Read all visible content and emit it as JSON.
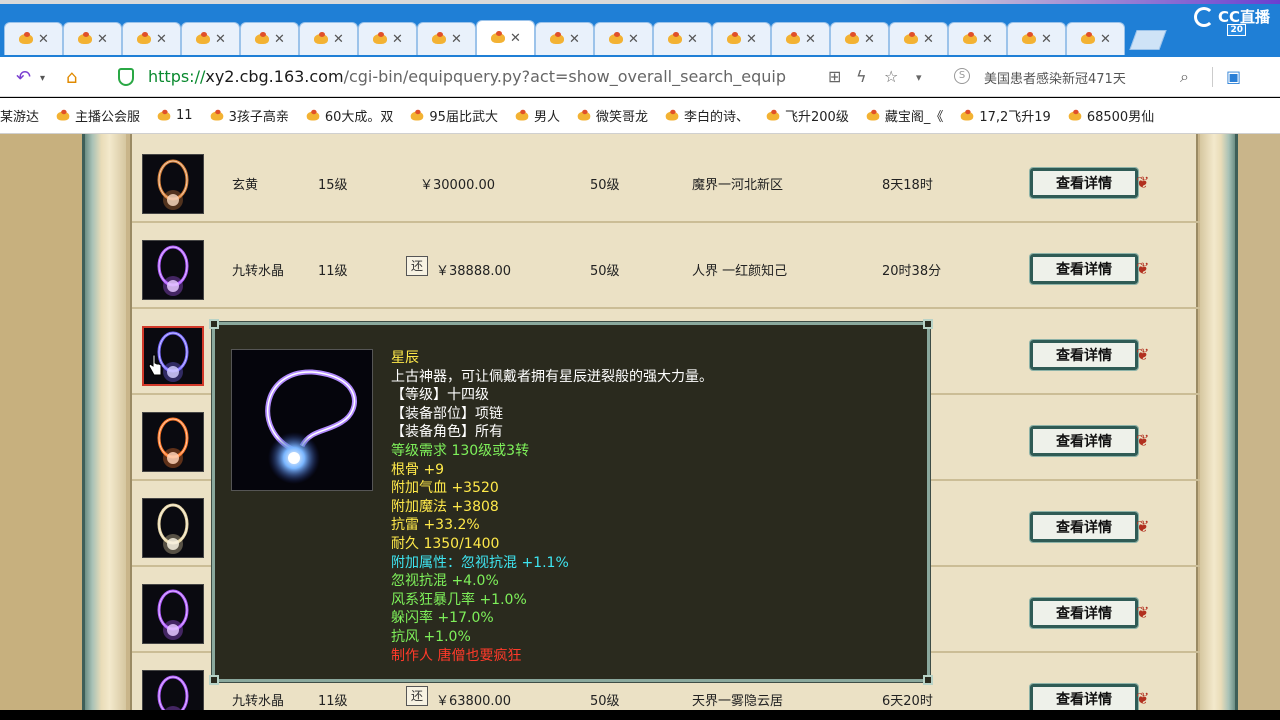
{
  "browser": {
    "tabs": [
      {
        "active": false
      },
      {
        "active": false
      },
      {
        "active": false
      },
      {
        "active": false
      },
      {
        "active": false
      },
      {
        "active": false
      },
      {
        "active": false
      },
      {
        "active": false
      },
      {
        "active": true
      },
      {
        "active": false
      },
      {
        "active": false
      },
      {
        "active": false
      },
      {
        "active": false
      },
      {
        "active": false
      },
      {
        "active": false
      },
      {
        "active": false
      },
      {
        "active": false
      },
      {
        "active": false
      },
      {
        "active": false
      }
    ],
    "tab_close_glyph": "✕",
    "stream_logo": "CC直播",
    "stream_badge": "20",
    "url_scheme": "https://",
    "url_host": "xy2.cbg.163.com",
    "url_path": "/cgi-bin/equipquery.py?act=show_overall_search_equip",
    "search_hint": "美国患者感染新冠471天",
    "bookmarks": [
      "某游达",
      "主播公会服",
      "11",
      "3孩子高亲",
      "60大成。双",
      "95届比武大",
      "男人",
      "微笑哥龙",
      "李白的诗、",
      "飞升200级",
      "藏宝阁_《",
      "17,2飞升19",
      "68500男仙"
    ]
  },
  "listing": {
    "button_label": "查看详情",
    "haggle_badge": "还",
    "rows": [
      {
        "name": "玄黄",
        "level": "15级",
        "price": "￥30000.00",
        "haggle": false,
        "grade": "50级",
        "server": "魔界一河北新区",
        "time": "8天18时",
        "icon_color": "#d9823a"
      },
      {
        "name": "九转水晶",
        "level": "11级",
        "price": "￥38888.00",
        "haggle": true,
        "grade": "50级",
        "server": "人界 一红颜知己",
        "time": "20时38分",
        "icon_color": "#b25cff"
      },
      {
        "name": "",
        "level": "",
        "price": "",
        "haggle": false,
        "grade": "",
        "server": "",
        "time": "",
        "icon_color": "#7a6bff",
        "selected": true
      },
      {
        "name": "",
        "level": "",
        "price": "",
        "haggle": false,
        "grade": "",
        "server": "",
        "time": "",
        "icon_color": "#ff7a2a"
      },
      {
        "name": "",
        "level": "",
        "price": "",
        "haggle": false,
        "grade": "",
        "server": "",
        "time": "",
        "icon_color": "#e8d7a8"
      },
      {
        "name": "",
        "level": "",
        "price": "",
        "haggle": false,
        "grade": "",
        "server": "",
        "time": "",
        "icon_color": "#b25cff"
      },
      {
        "name": "九转水晶",
        "level": "11级",
        "price": "￥63800.00",
        "haggle": true,
        "grade": "50级",
        "server": "天界一雾隐云居",
        "time": "6天20时",
        "icon_color": "#b25cff"
      }
    ]
  },
  "tooltip": {
    "lines": [
      {
        "text": "星辰",
        "color": "yellow"
      },
      {
        "text": "上古神器，可让佩戴者拥有星辰迸裂般的强大力量。",
        "color": "white"
      },
      {
        "text": "【等级】十四级",
        "color": "white"
      },
      {
        "text": "【装备部位】项链",
        "color": "white"
      },
      {
        "text": "【装备角色】所有",
        "color": "white"
      },
      {
        "text": "等级需求 130级或3转",
        "color": "green"
      },
      {
        "text": "根骨 +9",
        "color": "yellow"
      },
      {
        "text": "附加气血 +3520",
        "color": "yellow"
      },
      {
        "text": "附加魔法 +3808",
        "color": "yellow"
      },
      {
        "text": "抗雷 +33.2%",
        "color": "yellow"
      },
      {
        "text": "耐久 1350/1400",
        "color": "yellow"
      },
      {
        "text": "附加属性：忽视抗混 +1.1%",
        "color": "cyan"
      },
      {
        "text": "忽视抗混 +4.0%",
        "color": "green"
      },
      {
        "text": "风系狂暴几率 +1.0%",
        "color": "green"
      },
      {
        "text": "躲闪率 +17.0%",
        "color": "green"
      },
      {
        "text": "抗风 +1.0%",
        "color": "green"
      },
      {
        "text": "制作人 唐僧也要疯狂",
        "color": "red"
      }
    ]
  },
  "colors": {
    "tabbar": "#1f7fd6",
    "page_bg": "#ebe1c5",
    "tooltip_bg": "#2a2a1e",
    "button_border": "#2f5b55"
  }
}
